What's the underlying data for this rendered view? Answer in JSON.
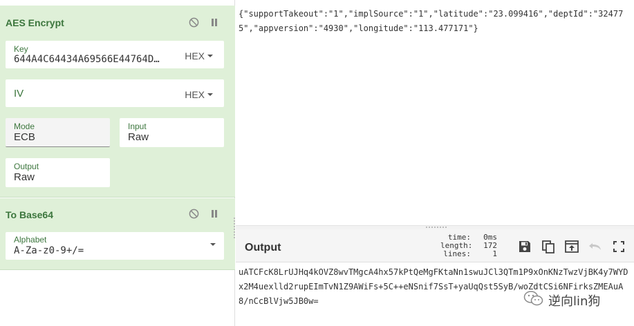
{
  "recipe": {
    "aes": {
      "title": "AES Encrypt",
      "key": {
        "label": "Key",
        "value": "644A4C64434A69566E44764D…",
        "format": "HEX"
      },
      "iv": {
        "label": "IV",
        "value": "",
        "placeholder": "IV",
        "format": "HEX"
      },
      "mode": {
        "label": "Mode",
        "value": "ECB"
      },
      "input": {
        "label": "Input",
        "value": "Raw"
      },
      "output": {
        "label": "Output",
        "value": "Raw"
      }
    },
    "base64": {
      "title": "To Base64",
      "alphabet": {
        "label": "Alphabet",
        "value": "A-Za-z0-9+/="
      }
    }
  },
  "input": {
    "text": "{\"supportTakeout\":\"1\",\"implSource\":\"1\",\"latitude\":\"23.099416\",\"deptId\":\"324775\",\"appversion\":\"4930\",\"longitude\":\"113.477171\"}"
  },
  "output": {
    "title": "Output",
    "stats": {
      "time_label": "time:",
      "time_value": "0ms",
      "length_label": "length:",
      "length_value": "172",
      "lines_label": "lines:",
      "lines_value": "1"
    },
    "text": "uATCFcK8LrUJHq4kOVZ8wvTMgcA4hx57kPtQeMgFKtaNn1swuJCl3QTm1P9xOnKNzTwzVjBK4y7WYDx2M4uexlld2rupEImTvN1Z9AWiFs+5C++eNSnif7SsT+yaUqQst5SyB/woZdtCSi6NFirksZMEAuA8/nCcBlVjw5JB0w="
  },
  "watermark": {
    "text": "逆向lin狗"
  },
  "icons": {
    "disable": "disable-icon",
    "pause": "pause-icon",
    "save": "save-icon",
    "copy": "copy-icon",
    "replace_input": "replace-input-icon",
    "undo": "undo-icon",
    "maximise": "maximise-icon"
  },
  "colors": {
    "op_bg": "#dff0d8",
    "op_label": "#3c763d"
  }
}
